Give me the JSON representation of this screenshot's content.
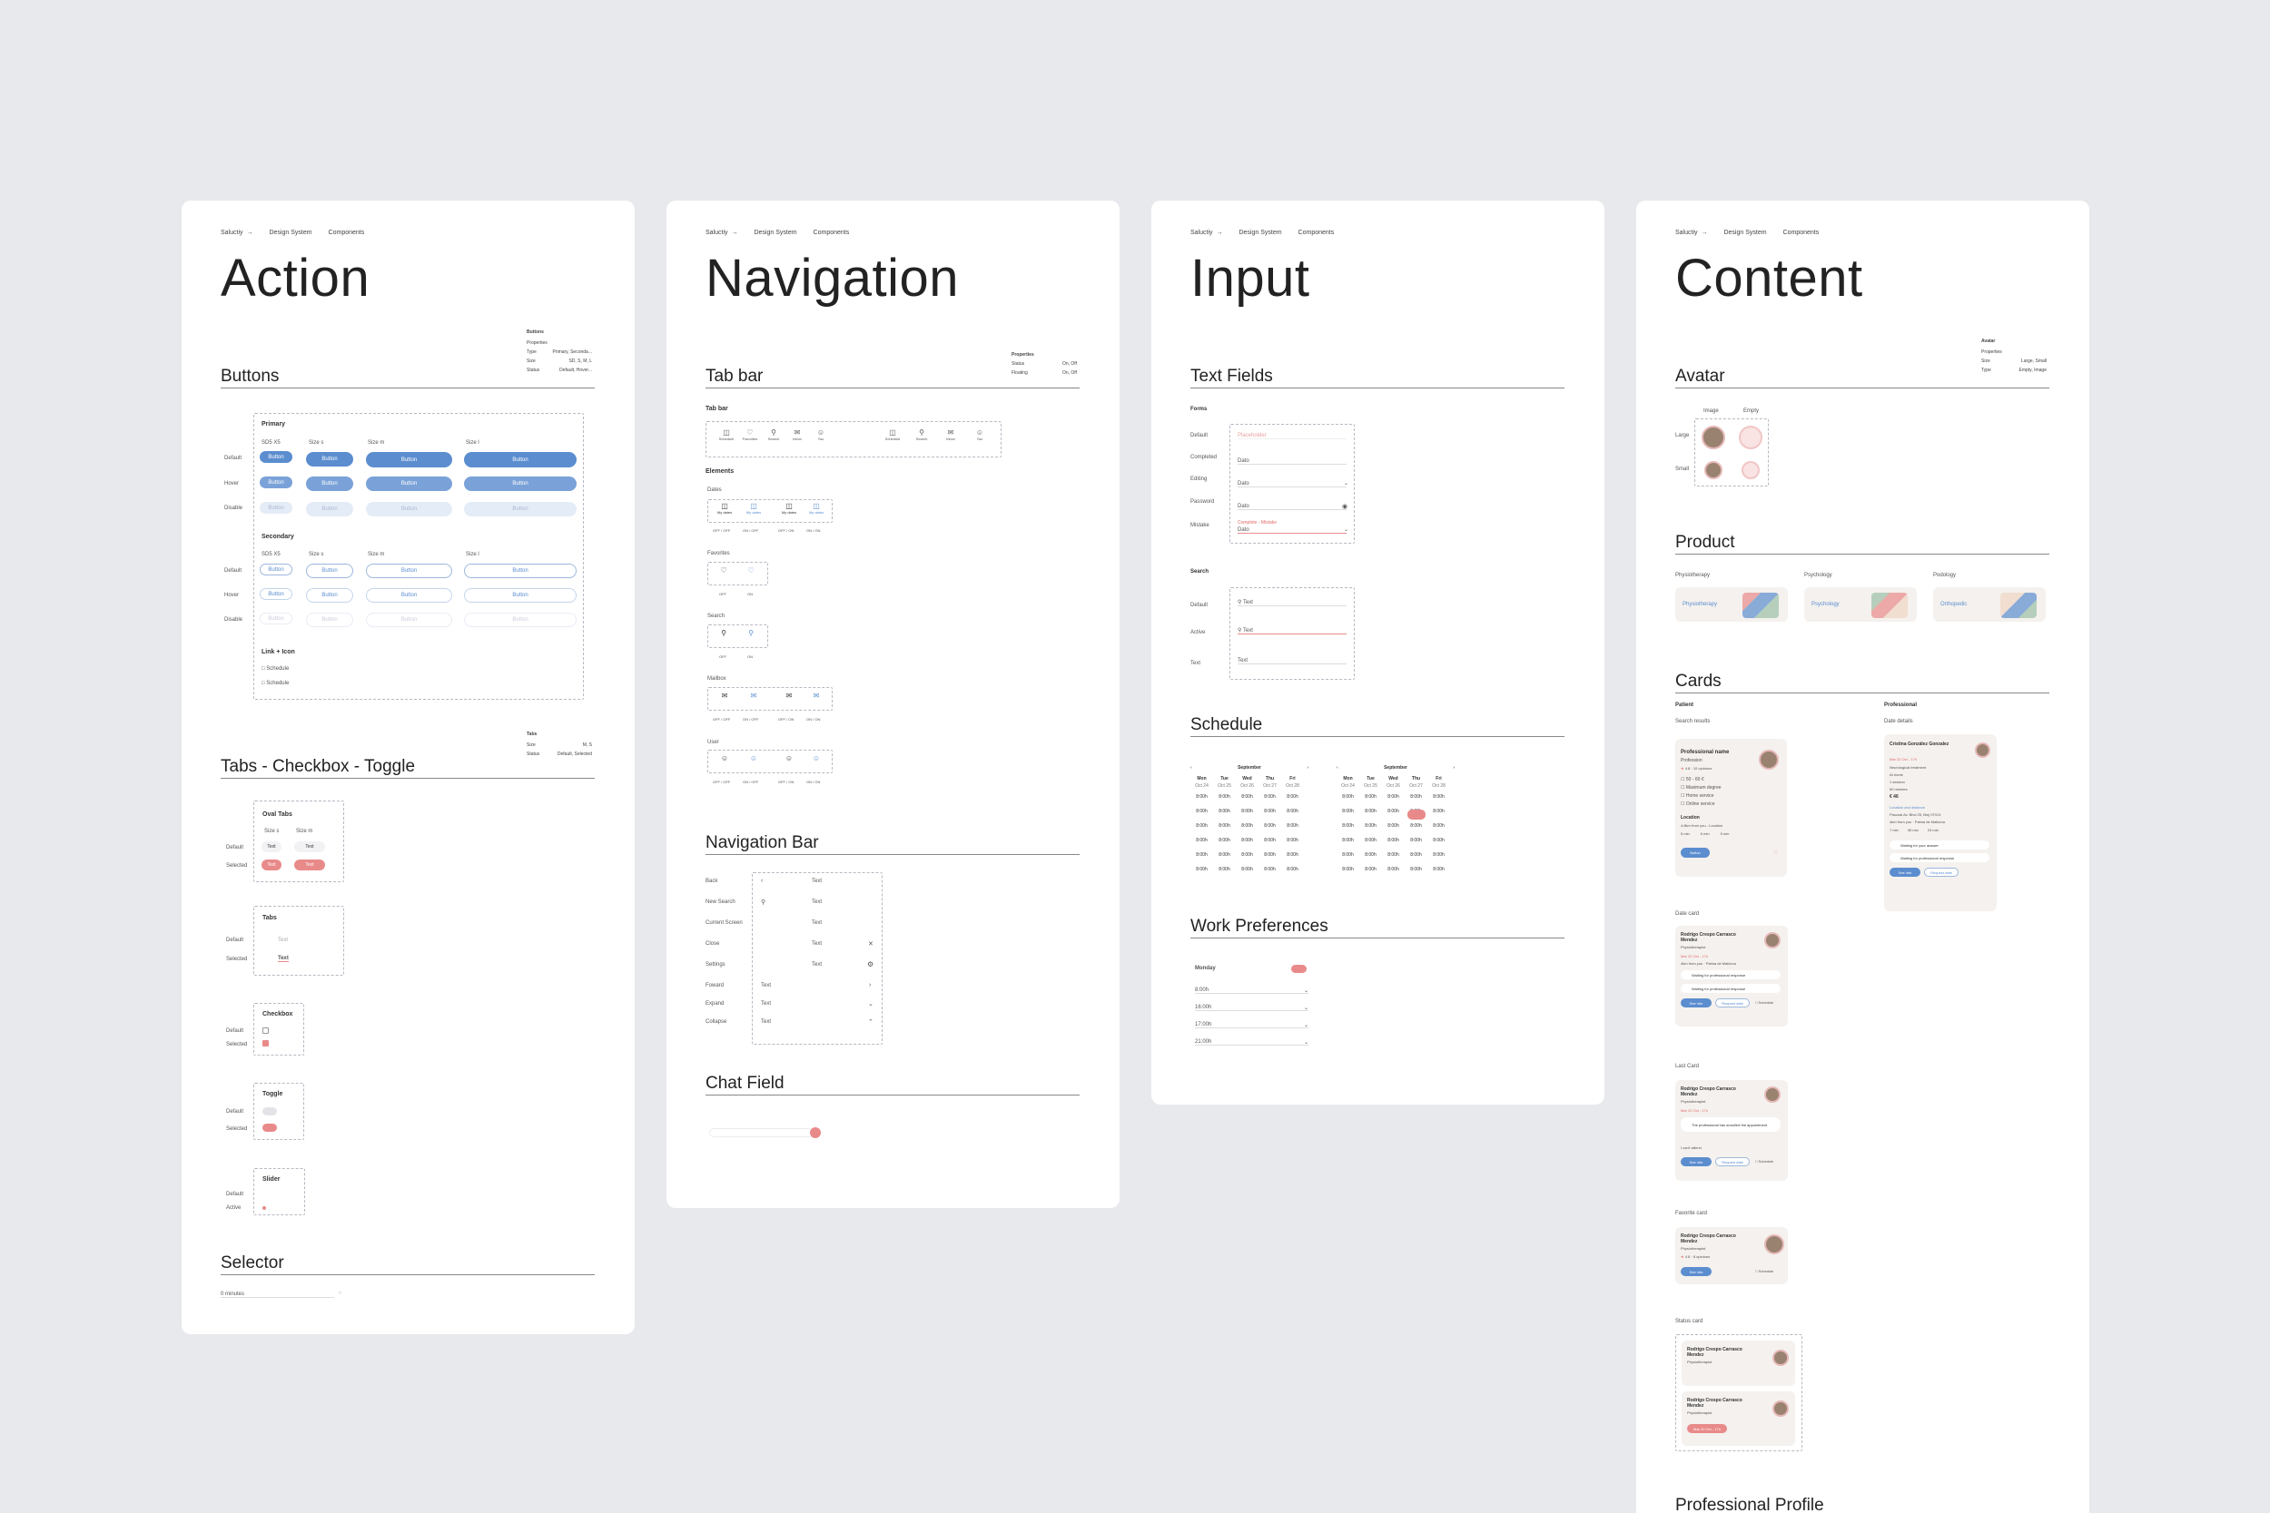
{
  "crumbs": [
    "Saluctiy",
    "Design System",
    "Components"
  ],
  "boards": {
    "action": {
      "title": "Action",
      "buttons_title": "Buttons",
      "props": [
        "Buttons",
        "Properties",
        "Type",
        "Size",
        "Status",
        "Primary, Seconda...",
        "SD, S, M, L",
        "Default, Hover..."
      ],
      "primary": "Primary",
      "secondary": "Secondary",
      "sizes": [
        "SD5 X5",
        "Size s",
        "Size m",
        "Size l"
      ],
      "states": [
        "Default",
        "Hover",
        "Disable"
      ],
      "button_label": "Button",
      "link_icon": "Link + Icon",
      "schedule": "Schedule",
      "tabs_title": "Tabs - Checkbox - Toggle",
      "tabs_props": [
        "Tabs",
        "Size",
        "Status",
        "M, S",
        "Default, Selected"
      ],
      "oval_tabs": "Oval Tabs",
      "size_s": "Size s",
      "size_m": "Size m",
      "default": "Default",
      "selected": "Selected",
      "text": "Text",
      "active": "Active",
      "tabs": "Tabs",
      "checkbox": "Checkbox",
      "toggle": "Toggle",
      "slider": "Slider",
      "selector_title": "Selector",
      "selector_value": "0 minutes"
    },
    "navigation": {
      "title": "Navigation",
      "tabbar_title": "Tab bar",
      "tabbar_lbl": "Tab bar",
      "props": [
        "Properties",
        "Status",
        "Floating",
        "On, Off",
        "On, Off"
      ],
      "tab_items": [
        "Schedule",
        "Favorites",
        "Search",
        "Inbox",
        "You"
      ],
      "tab_items2": [
        "Schedule",
        "Search",
        "Inbox",
        "You"
      ],
      "elements": "Elements",
      "groups": [
        "Dates",
        "Favorites",
        "Search",
        "Mailbox",
        "User"
      ],
      "dates_labels": [
        "My dates",
        "My dates",
        "My dates",
        "My dates"
      ],
      "states4": [
        "OFF / OFF",
        "ON / OFF",
        "OFF / ON",
        "ON / ON"
      ],
      "states2": [
        "OFF",
        "ON"
      ],
      "navbar_title": "Navigation Bar",
      "navbar_rows": [
        "Back",
        "New Search",
        "Current Screen",
        "Close",
        "Settings",
        "Foward",
        "Expand",
        "Collapse"
      ],
      "text": "Text",
      "chat_title": "Chat Field"
    },
    "input": {
      "title": "Input",
      "tf_title": "Text Fields",
      "forms": "Forms",
      "form_states": [
        "Default",
        "Completed",
        "Editing",
        "Password",
        "Mistake"
      ],
      "form_values": [
        "Placeholder",
        "Dato",
        "Dato",
        "Dato",
        "Dato"
      ],
      "mistake_msg": "Complete - Mistake",
      "search": "Search",
      "search_states": [
        "Default",
        "Active",
        "Text"
      ],
      "text": "Text",
      "schedule_title": "Schedule",
      "month": "September",
      "days": [
        "Mon",
        "Tue",
        "Wed",
        "Thu",
        "Fri"
      ],
      "dates": [
        "Oct 24",
        "Oct 25",
        "Oct 26",
        "Oct 27",
        "Oct 28"
      ],
      "dates2": [
        "Oct 24",
        "Oct 25",
        "Oct 26",
        "Oct 27",
        "Oct 28"
      ],
      "slot": "8:00h",
      "work_title": "Work Preferences",
      "weekday": "Monday",
      "times": [
        "8:00h",
        "16:00h",
        "17:00h",
        "21:00h"
      ]
    },
    "content": {
      "title": "Content",
      "avatar_title": "Avatar",
      "avatar_props": [
        "Avatar",
        "Properties",
        "Size",
        "Type",
        "Large, Small",
        "Empty, Image"
      ],
      "avatar_cols": [
        "Image",
        "Empty"
      ],
      "avatar_rows": [
        "Large",
        "Small"
      ],
      "product_title": "Product",
      "products": [
        "Physiotherapy",
        "Psychology",
        "Podology"
      ],
      "product_tags": [
        "Physiotherapy",
        "Psychology",
        "Orthopedic"
      ],
      "cards_title": "Cards",
      "patient": "Patient",
      "professional": "Professional",
      "search_results": "Search results",
      "date_details": "Date details",
      "prof_name": "Professional name",
      "prof_role": "Profession",
      "rating": "4.8 · 10 opinions",
      "checks": [
        "50 - 60 €",
        "Maximum degree",
        "Home service",
        "Online service"
      ],
      "location": "Location",
      "distance": "4.8km from you - Location",
      "times_short": [
        "5 min",
        "6 min",
        "5 min"
      ],
      "button": "Button",
      "cg_name": "Cristina González Gonzalez",
      "cg_date": "Mar 22 Oct - 17h",
      "cg_lines": [
        "Neurological treatment",
        "At home",
        "1 session",
        "60 minutes",
        "€ 46"
      ],
      "cg_loc": "Location and distance",
      "cg_addr": "Pascual Av. Blvd 25, Bmj 07013",
      "cg_far": "4km from you · Palma de Mallorca",
      "cg_times": [
        "7 min",
        "36 min",
        "23 min"
      ],
      "waiting": "Waiting for your answer",
      "waiting2": "Waiting for professional response",
      "date_card": "Date card",
      "last_card": "Last Card",
      "fav_card": "Favorite card",
      "status_card": "Status card",
      "rc_name": "Rodrigo Crespo Carrasco Mendez",
      "rc_role": "Physiotherapist",
      "rc_date": "Mar 22 Oct - 17h",
      "rc_far": "4km from you · Palma de Mallorca",
      "see_info": "See info",
      "request": "Request date",
      "schedule": "Schedule",
      "annulled": "The professional has annulled the appointment",
      "cant": "I can't attend",
      "fav_rating": "4.8 · 8 opinions",
      "status_tag": "Mar 22 Oct - 17h",
      "profile_title": "Professional Profile"
    }
  },
  "colors": {
    "bg": "#e8e9ec",
    "accent": "#5b8dcf",
    "pink": "#e98a8a"
  }
}
